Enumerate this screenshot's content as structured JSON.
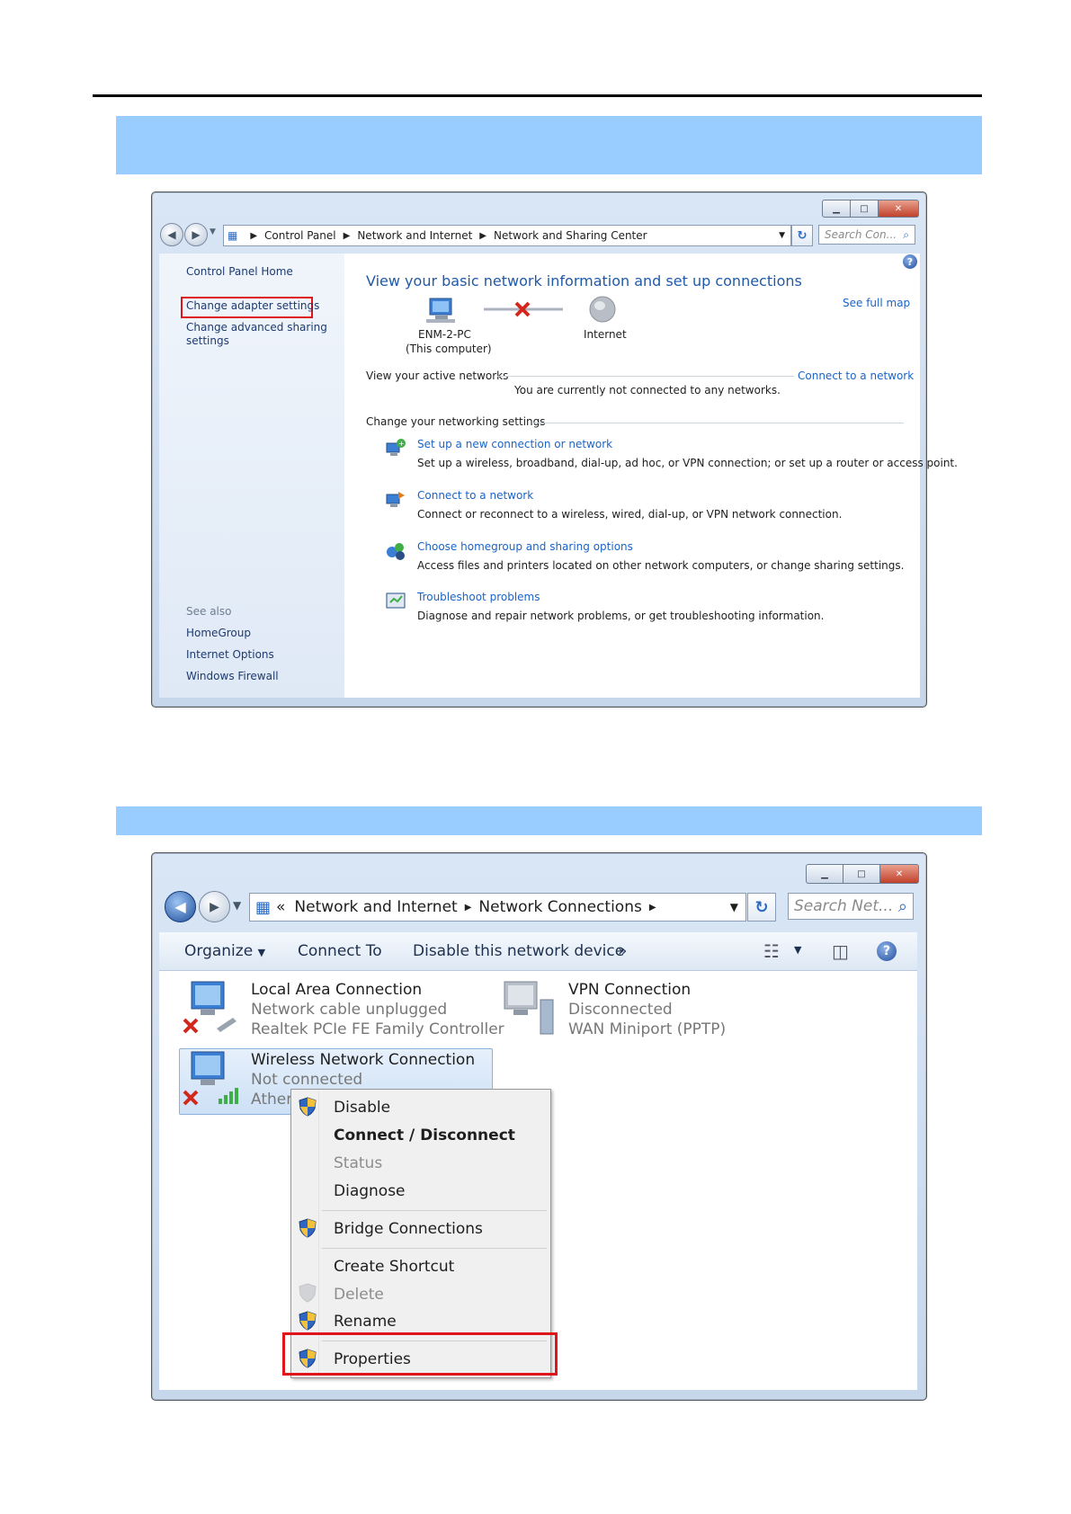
{
  "window1": {
    "breadcrumb": [
      "Control Panel",
      "Network and Internet",
      "Network and Sharing Center"
    ],
    "search_placeholder": "Search Con...",
    "sidebar": {
      "home": "Control Panel Home",
      "change_adapter": "Change adapter settings",
      "change_advanced_1": "Change advanced sharing",
      "change_advanced_2": "settings",
      "see_also": "See also",
      "homegroup": "HomeGroup",
      "internet_options": "Internet Options",
      "firewall": "Windows Firewall"
    },
    "main": {
      "heading": "View your basic network information and set up connections",
      "see_full_map": "See full map",
      "computer_name": "ENM-2-PC",
      "computer_sub": "(This computer)",
      "internet": "Internet",
      "active_networks": "View your active networks",
      "connect_to_network": "Connect to a network",
      "not_connected": "You are currently not connected to any networks.",
      "change_settings": "Change your networking settings",
      "tasks": [
        {
          "title": "Set up a new connection or network",
          "desc": "Set up a wireless, broadband, dial-up, ad hoc, or VPN connection; or set up a router or access point."
        },
        {
          "title": "Connect to a network",
          "desc": "Connect or reconnect to a wireless, wired, dial-up, or VPN network connection."
        },
        {
          "title": "Choose homegroup and sharing options",
          "desc": "Access files and printers located on other network computers, or change sharing settings."
        },
        {
          "title": "Troubleshoot problems",
          "desc": "Diagnose and repair network problems, or get troubleshooting information."
        }
      ]
    }
  },
  "window2": {
    "breadcrumb_prefix": "«",
    "breadcrumb": [
      "Network and Internet",
      "Network Connections"
    ],
    "search_placeholder": "Search Net...",
    "toolbar": {
      "organize": "Organize",
      "connect_to": "Connect To",
      "disable_device": "Disable this network device",
      "more": "»"
    },
    "connections": [
      {
        "name": "Local Area Connection",
        "status": "Network cable unplugged",
        "device": "Realtek PCIe FE Family Controller"
      },
      {
        "name": "VPN Connection",
        "status": "Disconnected",
        "device": "WAN Miniport (PPTP)"
      },
      {
        "name": "Wireless Network Connection",
        "status": "Not connected",
        "device": "Athero"
      }
    ],
    "context_menu": [
      "Disable",
      "Connect / Disconnect",
      "Status",
      "Diagnose",
      "Bridge Connections",
      "Create Shortcut",
      "Delete",
      "Rename",
      "Properties"
    ]
  },
  "colors": {
    "band": "#99ccff",
    "highlight": "#e0141b",
    "link": "#1a64c8"
  }
}
